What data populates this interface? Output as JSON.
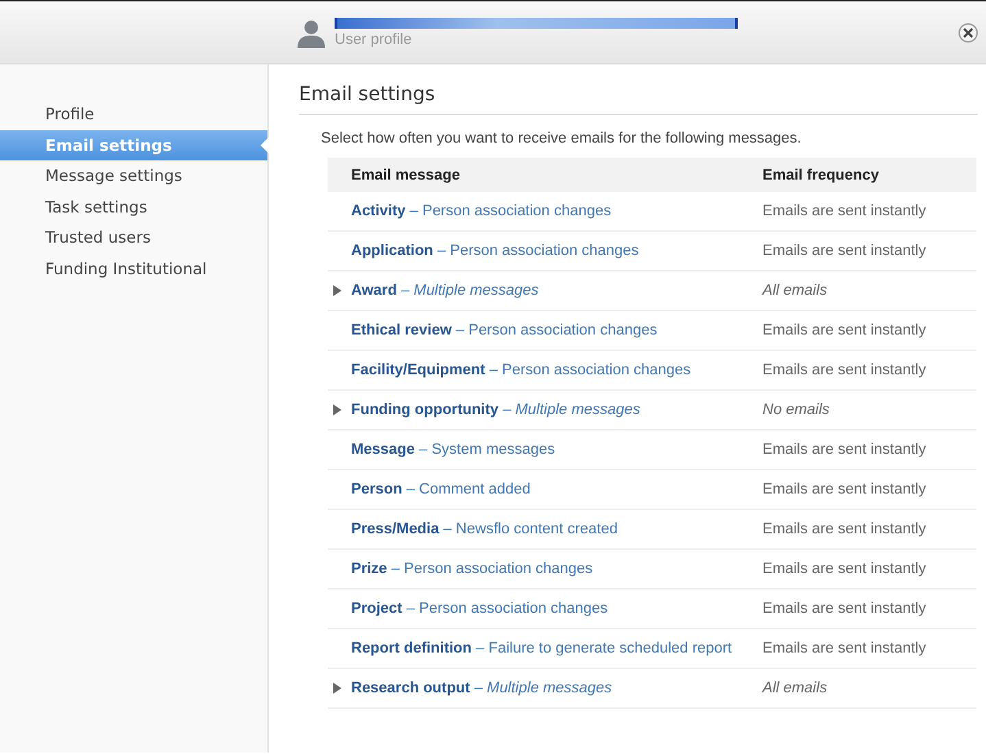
{
  "header": {
    "subtitle": "User profile"
  },
  "sidebar": {
    "items": [
      {
        "label": "Profile",
        "selected": false
      },
      {
        "label": "Email settings",
        "selected": true
      },
      {
        "label": "Message settings",
        "selected": false
      },
      {
        "label": "Task settings",
        "selected": false
      },
      {
        "label": "Trusted users",
        "selected": false
      },
      {
        "label": "Funding Institutional",
        "selected": false
      }
    ]
  },
  "content": {
    "title": "Email settings",
    "intro": "Select how often you want to receive emails for the following messages.",
    "table": {
      "columns": [
        "Email message",
        "Email frequency"
      ],
      "rows": [
        {
          "kind": "message",
          "message": "**Activity** – Person association changes",
          "frequency": "Emails are sent instantly"
        },
        {
          "kind": "message",
          "message": "**Application** – Person association changes",
          "frequency": "Emails are sent instantly"
        },
        {
          "kind": "group",
          "expanded": false,
          "message": "**Award** – *Multiple messages*",
          "frequency": "All emails"
        },
        {
          "kind": "message",
          "message": "**Ethical review** – Person association changes",
          "frequency": "Emails are sent instantly"
        },
        {
          "kind": "message",
          "message": "**Facility/Equipment** – Person association changes",
          "frequency": "Emails are sent instantly"
        },
        {
          "kind": "group",
          "expanded": false,
          "message": "**Funding opportunity** – *Multiple messages*",
          "frequency": "No emails"
        },
        {
          "kind": "message",
          "message": "**Message** – System messages",
          "frequency": "Emails are sent instantly"
        },
        {
          "kind": "message",
          "message": "**Person** – Comment added",
          "frequency": "Emails are sent instantly"
        },
        {
          "kind": "message",
          "message": "**Press/Media** – Newsflo content created",
          "frequency": "Emails are sent instantly"
        },
        {
          "kind": "message",
          "message": "**Prize** – Person association changes",
          "frequency": "Emails are sent instantly"
        },
        {
          "kind": "message",
          "message": "**Project** – Person association changes",
          "frequency": "Emails are sent instantly"
        },
        {
          "kind": "message",
          "message": "**Report definition** – Failure to generate scheduled report",
          "frequency": "Emails are sent instantly"
        },
        {
          "kind": "group",
          "expanded": false,
          "message": "**Research output** – *Multiple messages*",
          "frequency": "All emails"
        }
      ]
    }
  }
}
